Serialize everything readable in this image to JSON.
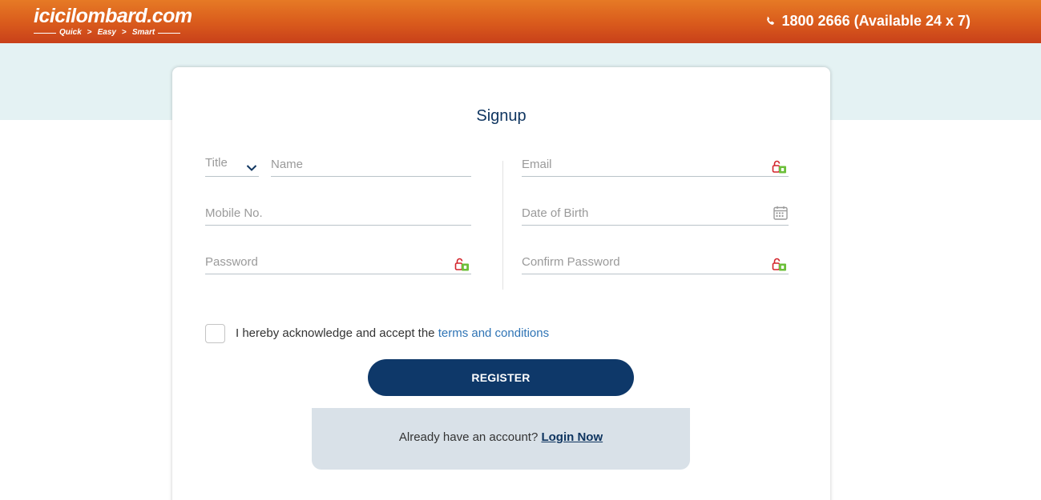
{
  "header": {
    "logo_text": "icicilombard.com",
    "tagline": [
      "Quick",
      "Easy",
      "Smart"
    ],
    "phone": "1800 2666 (Available 24 x 7)"
  },
  "form": {
    "title": "Signup",
    "fields": {
      "title_select": "Title",
      "name": "Name",
      "email": "Email",
      "mobile": "Mobile No.",
      "dob": "Date of Birth",
      "password": "Password",
      "confirm_password": "Confirm Password"
    },
    "consent_text": "I hereby acknowledge and accept the",
    "terms_link": "terms and conditions",
    "register_label": "REGISTER",
    "login_prompt": "Already have an account?",
    "login_link": "Login Now"
  },
  "colors": {
    "header_orange": "#d95a1c",
    "navy": "#0e3869",
    "link_blue": "#2f74b5",
    "band": "#e4f2f3"
  },
  "icons": {
    "phone": "phone-icon",
    "chevron": "chevron-down-icon",
    "secure_field": "lock-key-icon",
    "calendar": "calendar-icon"
  }
}
